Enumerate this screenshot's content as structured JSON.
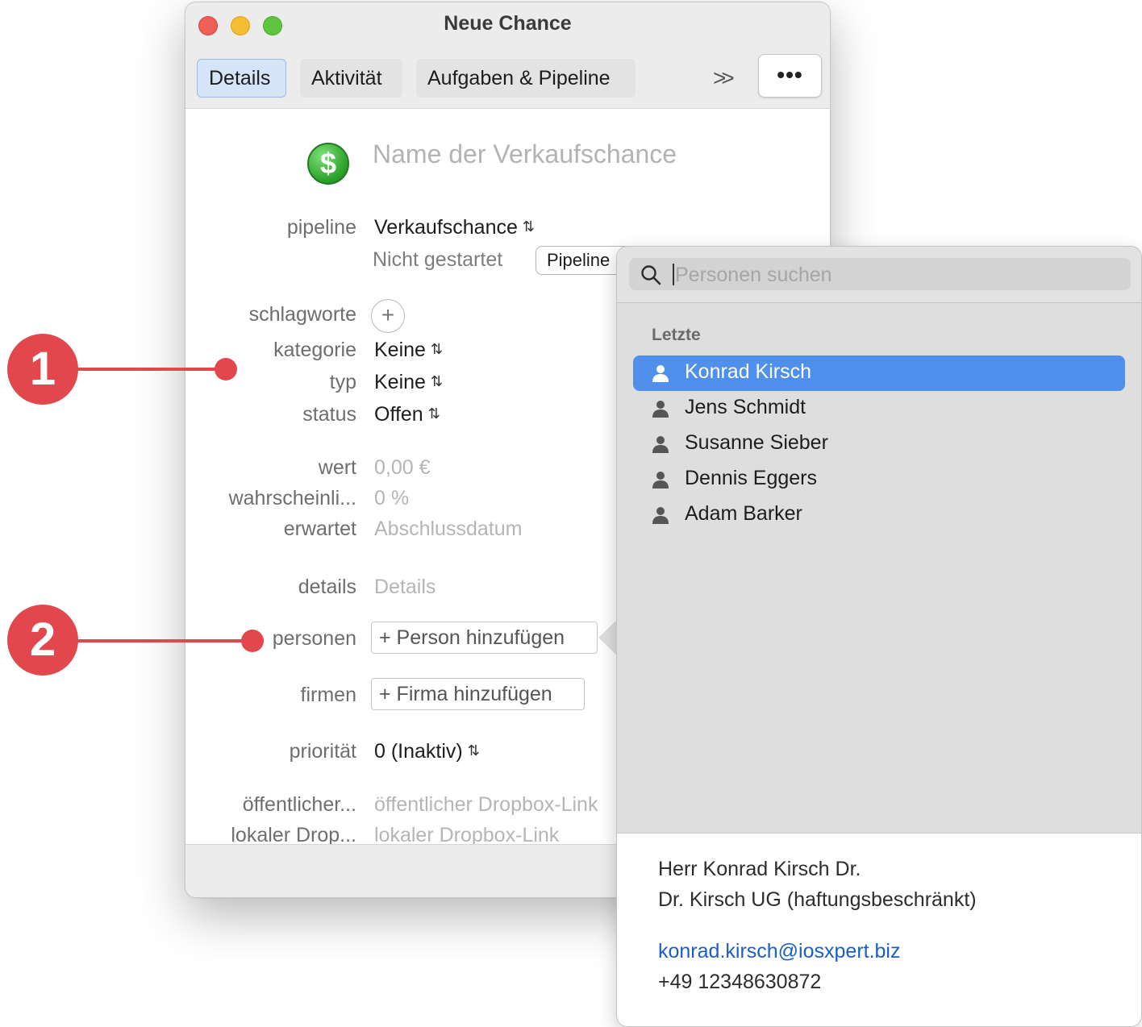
{
  "window": {
    "title": "Neue Chance",
    "tabs": [
      "Details",
      "Aktivität",
      "Aufgaben & Pipeline"
    ],
    "overflow_label": ">>",
    "more_label": "•••"
  },
  "form": {
    "name_placeholder": "Name der Verkaufschance",
    "dollar_glyph": "$",
    "pipeline": {
      "label": "pipeline",
      "value": "Verkaufschance",
      "status": "Nicht gestartet",
      "button": "Pipeline"
    },
    "schlagworte": {
      "label": "schlagworte",
      "add": "+"
    },
    "kategorie": {
      "label": "kategorie",
      "value": "Keine"
    },
    "typ": {
      "label": "typ",
      "value": "Keine"
    },
    "status": {
      "label": "status",
      "value": "Offen"
    },
    "wert": {
      "label": "wert",
      "placeholder": "0,00 €"
    },
    "wahrscheinlichkeit": {
      "label": "wahrscheinli...",
      "placeholder": "0 %"
    },
    "erwartet": {
      "label": "erwartet",
      "placeholder": "Abschlussdatum"
    },
    "details": {
      "label": "details",
      "placeholder": "Details"
    },
    "personen": {
      "label": "personen",
      "button": "+ Person hinzufügen"
    },
    "firmen": {
      "label": "firmen",
      "button": "+ Firma hinzufügen"
    },
    "prioritaet": {
      "label": "priorität",
      "value": "0 (Inaktiv)"
    },
    "dropbox_public": {
      "label": "öffentlicher...",
      "placeholder": "öffentlicher Dropbox-Link"
    },
    "dropbox_local": {
      "label": "lokaler Drop...",
      "placeholder": "lokaler Dropbox-Link"
    }
  },
  "popover": {
    "search_placeholder": "Personen suchen",
    "section": "Letzte",
    "people": [
      "Konrad Kirsch",
      "Jens Schmidt",
      "Susanne Sieber",
      "Dennis Eggers",
      "Adam Barker"
    ],
    "selected_index": 0,
    "detail": {
      "name": "Herr Konrad Kirsch Dr.",
      "company": "Dr. Kirsch UG (haftungsbeschränkt)",
      "email": "konrad.kirsch@iosxpert.biz",
      "phone": "+49 12348630872"
    }
  },
  "callouts": [
    "1",
    "2"
  ],
  "colors": {
    "accent": "#4f90ec",
    "callout": "#e2474d",
    "link": "#1a5fc4"
  }
}
